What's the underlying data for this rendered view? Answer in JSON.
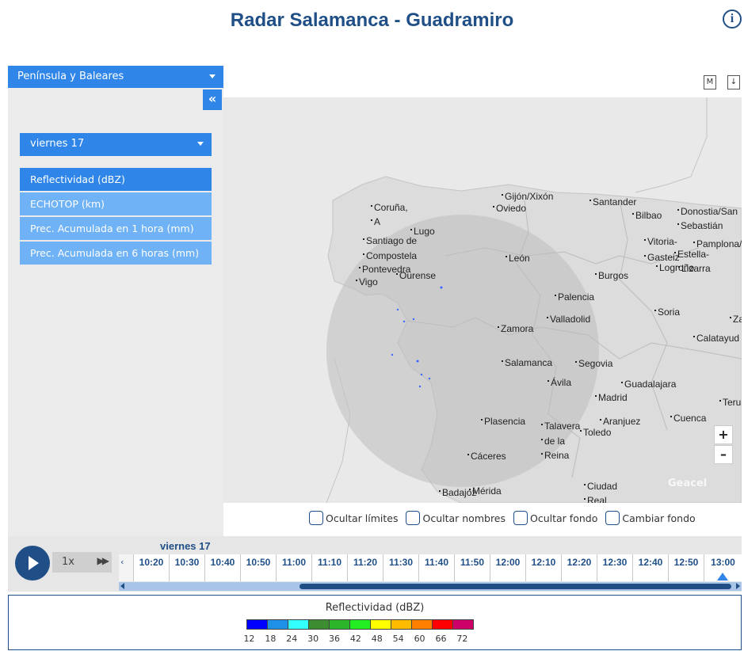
{
  "header": {
    "title": "Radar  Salamanca - Guadramiro",
    "info_icon": "i"
  },
  "sidebar": {
    "region": "Península y Baleares",
    "collapse_label": "«",
    "day": "viernes 17",
    "layers": [
      {
        "label": "Reflectividad (dBZ)",
        "active": true
      },
      {
        "label": "ECHOTOP (km)",
        "active": false
      },
      {
        "label": "Prec. Acumulada en 1 hora (mm)",
        "active": false
      },
      {
        "label": "Prec. Acumulada en 6 horas (mm)",
        "active": false
      }
    ]
  },
  "map": {
    "tools": {
      "metadata": "M",
      "download": "↓"
    },
    "cities": [
      "Gijón/Xixón",
      "Oviedo",
      "Santander",
      "Bilbao",
      "Donostia/San",
      "Sebastián",
      "Coruña,",
      "A",
      "Lugo",
      "Santiago de",
      "Compostela",
      "Pontevedra",
      "Ourense",
      "Vigo",
      "León",
      "Vitoria-",
      "Gasteiz",
      "Pamplona/",
      "Estella-",
      "Logroño",
      "Lizarra",
      "Burgos",
      "Palencia",
      "Valladolid",
      "Soria",
      "Zamora",
      "Za",
      "Calatayud",
      "Salamanca",
      "Segovia",
      "Guadalajara",
      "Ávila",
      "Madrid",
      "Teru",
      "Plasencia",
      "Talavera",
      "de la",
      "Reina",
      "Aranjuez",
      "Toledo",
      "Cuenca",
      "Cáceres",
      "Badajoz",
      "Mérida",
      "Ciudad",
      "Real"
    ],
    "zoom_in": "+",
    "zoom_out": "–",
    "watermark": "Geacel"
  },
  "options": [
    "Ocultar límites",
    "Ocultar nombres",
    "Ocultar fondo",
    "Cambiar fondo"
  ],
  "timeline": {
    "speed": "1x",
    "fast_forward": "▶▶",
    "day": "viernes 17",
    "times": [
      "10:20",
      "10:30",
      "10:40",
      "10:50",
      "11:00",
      "11:10",
      "11:20",
      "11:30",
      "11:40",
      "11:50",
      "12:00",
      "12:10",
      "12:20",
      "12:30",
      "12:40",
      "12:50",
      "13:00"
    ],
    "left_arrow": "‹"
  },
  "legend": {
    "title": "Reflectividad (dBZ)",
    "colors": [
      "#0000ff",
      "#1e90e6",
      "#33ffff",
      "#3c8d2f",
      "#2bb52b",
      "#22ee22",
      "#ffff00",
      "#ffbb00",
      "#ff7f00",
      "#ff0000",
      "#cc0066"
    ],
    "ticks": [
      "12",
      "18",
      "24",
      "30",
      "36",
      "42",
      "48",
      "54",
      "60",
      "66",
      "72"
    ]
  }
}
